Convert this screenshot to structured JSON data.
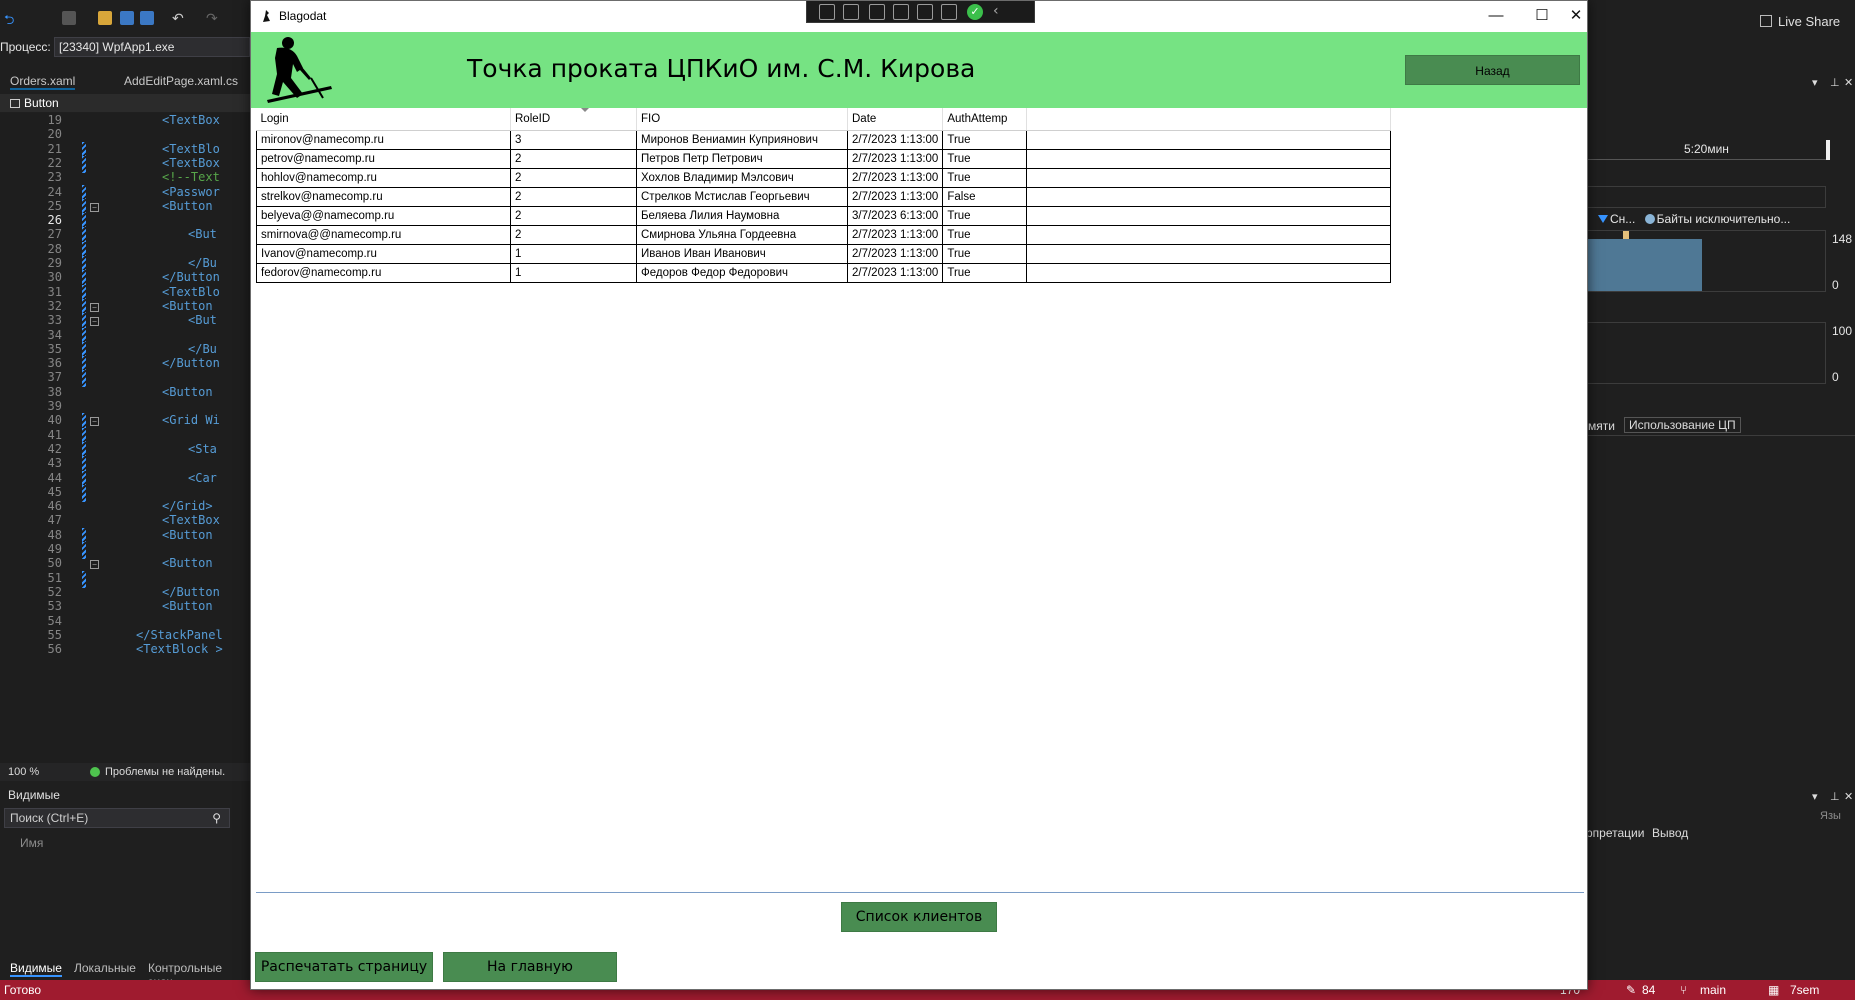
{
  "ide": {
    "live_share": "Live Share",
    "process_label": "Процесс:",
    "process_value": "[23340] WpfApp1.exe",
    "tabs": [
      "Orders.xaml",
      "AddEditPage.xaml.cs"
    ],
    "element_selector": "Button",
    "zoom": "100 %",
    "problems": "Проблемы не найдены.",
    "watch": {
      "title": "Видимые",
      "search_placeholder": "Поиск (Ctrl+E)",
      "column_name": "Имя",
      "tabs": [
        "Видимые",
        "Локальные",
        "Контрольные знач"
      ]
    },
    "code_lines": [
      {
        "n": "19",
        "text": "<TextBox"
      },
      {
        "n": "20",
        "text": ""
      },
      {
        "n": "21",
        "text": "<TextBlo"
      },
      {
        "n": "22",
        "text": "<TextBox"
      },
      {
        "n": "23",
        "text": "<!--Text"
      },
      {
        "n": "24",
        "text": "<Passwor"
      },
      {
        "n": "25",
        "text": "<Button"
      },
      {
        "n": "26",
        "text": ""
      },
      {
        "n": "27",
        "text": "<But"
      },
      {
        "n": "28",
        "text": ""
      },
      {
        "n": "29",
        "text": "</Bu"
      },
      {
        "n": "30",
        "text": "</Button"
      },
      {
        "n": "31",
        "text": "<TextBlo"
      },
      {
        "n": "32",
        "text": "<Button"
      },
      {
        "n": "33",
        "text": "<But"
      },
      {
        "n": "34",
        "text": ""
      },
      {
        "n": "35",
        "text": "</Bu"
      },
      {
        "n": "36",
        "text": "</Button"
      },
      {
        "n": "37",
        "text": ""
      },
      {
        "n": "38",
        "text": "<Button"
      },
      {
        "n": "39",
        "text": ""
      },
      {
        "n": "40",
        "text": "<Grid Wi"
      },
      {
        "n": "41",
        "text": ""
      },
      {
        "n": "42",
        "text": "<Sta"
      },
      {
        "n": "43",
        "text": ""
      },
      {
        "n": "44",
        "text": "<Car"
      },
      {
        "n": "45",
        "text": ""
      },
      {
        "n": "46",
        "text": "</Grid>"
      },
      {
        "n": "47",
        "text": "<TextBox"
      },
      {
        "n": "48",
        "text": "<Button"
      },
      {
        "n": "49",
        "text": ""
      },
      {
        "n": "50",
        "text": "<Button"
      },
      {
        "n": "51",
        "text": ""
      },
      {
        "n": "52",
        "text": "</Button"
      },
      {
        "n": "53",
        "text": "<Button"
      },
      {
        "n": "54",
        "text": ""
      },
      {
        "n": "55",
        "text": "</StackPanel"
      },
      {
        "n": "56",
        "text": "<TextBlock >"
      }
    ],
    "current_line": "26",
    "diagnostics": {
      "time": "5:20мин",
      "legend_a": "Сн...",
      "legend_b": "Байты исключительно...",
      "axis1_max": "148",
      "axis1_min": "0",
      "axis2_max": "100",
      "axis2_min": "0",
      "tabs": [
        "мяти",
        "Использование ЦП"
      ],
      "lower_tabs": [
        "рпретации",
        "Вывод"
      ],
      "lang": "Язы"
    },
    "statusbar": {
      "ready": "Готово",
      "lines": "170",
      "edits": "84",
      "branch": "main",
      "repo": "7sem"
    }
  },
  "app": {
    "window_title": "Blagodat",
    "heading": "Точка проката ЦПКиО им. С.М. Кирова",
    "back_button": "Назад",
    "grid": {
      "columns": [
        "Login",
        "RoleID",
        "FIO",
        "Date",
        "AuthAttemp"
      ],
      "sorted_column": "RoleID",
      "rows": [
        [
          "mironov@namecomp.ru",
          "3",
          "Миронов Вениамин Куприянович",
          "2/7/2023 1:13:00",
          "True"
        ],
        [
          "petrov@namecomp.ru",
          "2",
          "Петров Петр Петрович",
          "2/7/2023 1:13:00",
          "True"
        ],
        [
          "hohlov@namecomp.ru",
          "2",
          "Хохлов Владимир Мэлсович",
          "2/7/2023 1:13:00",
          "True"
        ],
        [
          "strelkov@namecomp.ru",
          "2",
          "Стрелков Мстислав Георгьевич",
          "2/7/2023 1:13:00",
          "False"
        ],
        [
          "belyeva@@namecomp.ru",
          "2",
          "Беляева Лилия Наумовна",
          "3/7/2023 6:13:00",
          "True"
        ],
        [
          "smirnova@@namecomp.ru",
          "2",
          "Смирнова Ульяна Гордеевна",
          "2/7/2023 1:13:00",
          "True"
        ],
        [
          "Ivanov@namecomp.ru",
          "1",
          "Иванов Иван Иванович",
          "2/7/2023 1:13:00",
          "True"
        ],
        [
          "fedorov@namecomp.ru",
          "1",
          "Федоров Федор Федорович",
          "2/7/2023 1:13:00",
          "True"
        ]
      ]
    },
    "clients_button": "Список клиентов",
    "print_button": "Распечатать страницу",
    "home_button": "На главную"
  }
}
